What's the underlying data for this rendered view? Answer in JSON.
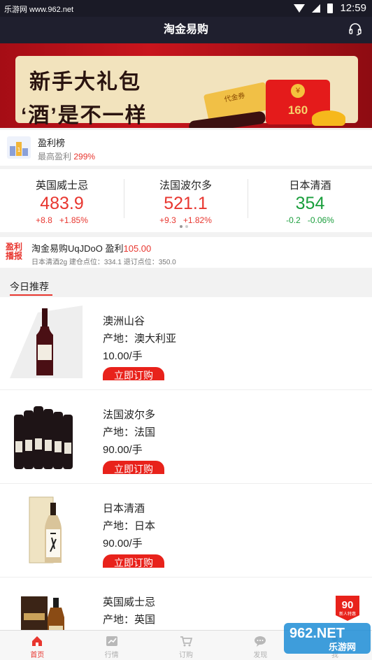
{
  "status_bar": {
    "site": "乐游网 www.962.net",
    "time": "12:59"
  },
  "header": {
    "title": "淘金易购",
    "service_icon": "headset-icon"
  },
  "banner": {
    "line1": "新手大礼包",
    "line2": "‘酒’是不一样",
    "red_packet_amount": "160",
    "coin_text": "¥",
    "ticket_text": "代金券"
  },
  "profit_rank": {
    "title": "盈利榜",
    "subtitle": "最高盈利",
    "value": "299%"
  },
  "quotes": [
    {
      "name": "英国威士忌",
      "price": "483.9",
      "change": "+8.8",
      "change_pct": "+1.85%",
      "trend": "up"
    },
    {
      "name": "法国波尔多",
      "price": "521.1",
      "change": "+9.3",
      "change_pct": "+1.82%",
      "trend": "up"
    },
    {
      "name": "日本清酒",
      "price": "354",
      "change": "-0.2",
      "change_pct": "-0.06%",
      "trend": "down"
    }
  ],
  "broadcast": {
    "badge": "盈利播报",
    "user": "淘金易购UqJDoO",
    "profit_label": "盈利",
    "profit_value": "105.00",
    "detail": "日本清酒2g  建仓点位：334.1  退订点位：350.0"
  },
  "section": {
    "title": "今日推荐"
  },
  "products": [
    {
      "name": "澳洲山谷",
      "origin": "产地：澳大利亚",
      "price": "10.00/手",
      "button": "立即订购"
    },
    {
      "name": "法国波尔多",
      "origin": "产地：法国",
      "price": "90.00/手",
      "button": "立即订购"
    },
    {
      "name": "日本清酒",
      "origin": "产地：日本",
      "price": "90.00/手",
      "button": "立即订购"
    },
    {
      "name": "英国威士忌",
      "origin": "产地：英国",
      "price": "",
      "button": ""
    }
  ],
  "float_badge": {
    "number": "90",
    "label": "新人特惠"
  },
  "tabs": [
    {
      "label": "首页",
      "icon": "home-icon",
      "active": true
    },
    {
      "label": "行情",
      "icon": "chart-icon",
      "active": false
    },
    {
      "label": "订购",
      "icon": "cart-icon",
      "active": false
    },
    {
      "label": "发现",
      "icon": "chat-icon",
      "active": false
    },
    {
      "label": "我",
      "icon": "user-icon",
      "active": false
    }
  ],
  "watermark": {
    "line1": "962.NET",
    "line2": "乐游网"
  },
  "colors": {
    "accent": "#e8362f",
    "up": "#e8362f",
    "down": "#1a9e3c",
    "header_bg": "#1f1f2e"
  }
}
